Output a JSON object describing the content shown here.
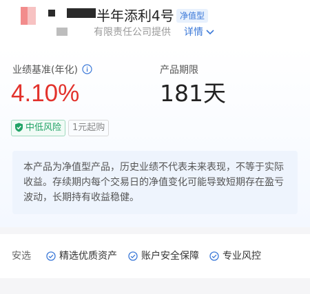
{
  "header": {
    "fund_name_tail": "半年添利4号",
    "type_tag": "净值型",
    "issuer_tail": "有限责任公司提供",
    "detail_link": "详情"
  },
  "metrics": {
    "yield_label": "业绩基准(年化)",
    "yield_value": "4.10%",
    "term_label": "产品期限",
    "term_value": "181天"
  },
  "tags": {
    "risk": "中低风险",
    "min_purchase": "1元起购"
  },
  "notice": "本产品为净值型产品，历史业绩不代表未来表现，不等于实际收益。存续期内每个交易日的净值变化可能导致短期存在盈亏波动，长期持有收益稳健。",
  "safety": {
    "title": "安选",
    "features": [
      "精选优质资产",
      "账户安全保障",
      "专业风控"
    ]
  },
  "colors": {
    "accent_blue": "#3a78d8",
    "yield_red": "#e2322c",
    "risk_green": "#21a366"
  },
  "icons": {
    "info": "info-circle-icon",
    "risk": "shield-check-icon",
    "feature": "check-circle-icon",
    "detail": "chevron-down-icon"
  }
}
